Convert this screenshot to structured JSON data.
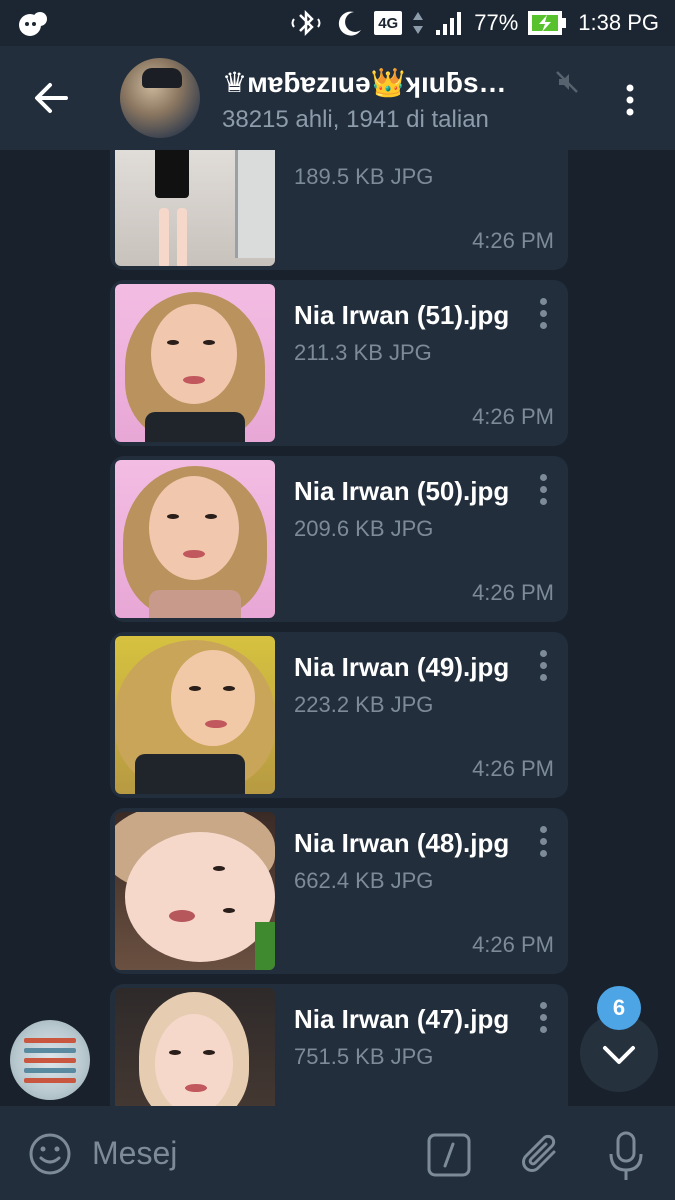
{
  "status_bar": {
    "network": "4G",
    "battery": "77%",
    "time": "1:38 PG"
  },
  "header": {
    "title": "♛ᴍɐƃɐzıuǝ👑ʞıuƃs…",
    "subtitle": "38215 ahli, 1941 di talian"
  },
  "messages": [
    {
      "file_name": "",
      "size": "189.5 KB JPG",
      "time": "4:26 PM"
    },
    {
      "file_name": "Nia Irwan (51).jpg",
      "size": "211.3 KB JPG",
      "time": "4:26 PM"
    },
    {
      "file_name": "Nia Irwan (50).jpg",
      "size": "209.6 KB JPG",
      "time": "4:26 PM"
    },
    {
      "file_name": "Nia Irwan (49).jpg",
      "size": "223.2 KB JPG",
      "time": "4:26 PM"
    },
    {
      "file_name": "Nia Irwan (48).jpg",
      "size": "662.4 KB JPG",
      "time": "4:26 PM"
    },
    {
      "file_name": "Nia Irwan (47).jpg",
      "size": "751.5 KB JPG",
      "time": ""
    }
  ],
  "scroll_badge": "6",
  "input": {
    "placeholder": "Mesej"
  },
  "colors": {
    "background": "#18212c",
    "header": "#232e3c",
    "bubble": "#222e3c",
    "accent": "#4da5e6",
    "muted_text": "#7d8a98"
  }
}
